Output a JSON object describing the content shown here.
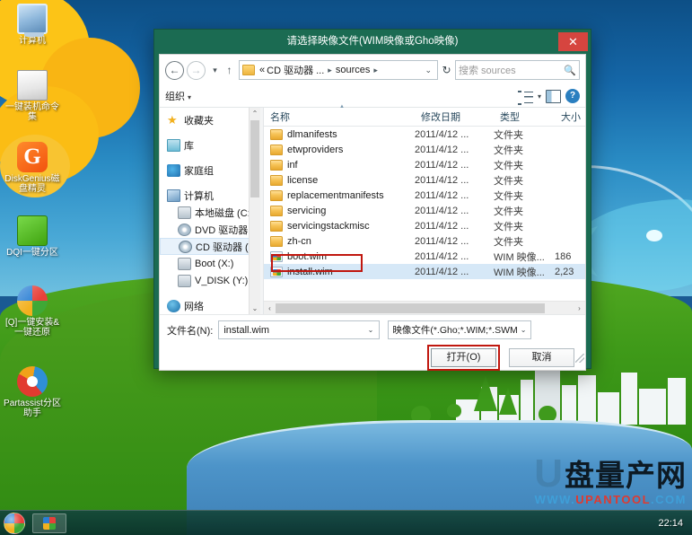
{
  "desktop": {
    "icons": [
      {
        "name": "computer",
        "label": "计算机",
        "icon": "computer-icon"
      },
      {
        "name": "one-key-command-set",
        "label": "一键装机命令集",
        "icon": "command-set-icon"
      },
      {
        "name": "diskgenius",
        "label": "DiskGenius磁盘精灵",
        "icon": "diskgenius-icon",
        "glyph": "G"
      },
      {
        "name": "dqi-partition",
        "label": "DQI一键分区",
        "icon": "partition-icon"
      },
      {
        "name": "q-install-restore",
        "label": "[Q]一键安装&一键还原",
        "icon": "windows-icon"
      },
      {
        "name": "partassist",
        "label": "Partassist分区助手",
        "icon": "partassist-icon"
      }
    ]
  },
  "dialog": {
    "title": "请选择映像文件(WIM映像或Gho映像)",
    "close_label": "✕",
    "nav": {
      "back_label": "←",
      "forward_label": "→",
      "recent_label": "▾",
      "up_label": "↑"
    },
    "address": {
      "prefix": "«",
      "segments": [
        "CD 驱动器 ...",
        "sources"
      ],
      "separator": "▸",
      "dropdown_label": "⌄",
      "refresh_label": "↻"
    },
    "search": {
      "placeholder": "搜索 sources",
      "value": "",
      "display": "搜索 sources",
      "icon": "search-icon"
    },
    "toolbar": {
      "organize_label": "组织",
      "organize_caret": "▾",
      "view_caret": "▾",
      "view_icon": "view-list-icon",
      "preview_icon": "preview-pane-icon",
      "help_label": "?"
    },
    "navpane": {
      "items": [
        {
          "label": "收藏夹",
          "icon": "star-icon",
          "level": 0,
          "selected": false,
          "spacer_after": true
        },
        {
          "label": "库",
          "icon": "library-icon",
          "level": 0,
          "selected": false,
          "spacer_after": true
        },
        {
          "label": "家庭组",
          "icon": "homegroup-icon",
          "level": 0,
          "selected": false,
          "spacer_after": true
        },
        {
          "label": "计算机",
          "icon": "computer-icon",
          "level": 0,
          "selected": false,
          "spacer_after": false
        },
        {
          "label": "本地磁盘 (C:)",
          "icon": "drive-icon",
          "level": 1,
          "selected": false,
          "spacer_after": false
        },
        {
          "label": "DVD 驱动器 (D:)",
          "icon": "dvd-drive-icon",
          "level": 1,
          "selected": false,
          "spacer_after": false
        },
        {
          "label": "CD 驱动器 (E:) G",
          "icon": "cd-drive-icon",
          "level": 1,
          "selected": true,
          "spacer_after": false
        },
        {
          "label": "Boot (X:)",
          "icon": "drive-icon",
          "level": 1,
          "selected": false,
          "spacer_after": false
        },
        {
          "label": "V_DISK (Y:)",
          "icon": "drive-icon",
          "level": 1,
          "selected": false,
          "spacer_after": true
        },
        {
          "label": "网络",
          "icon": "network-icon",
          "level": 0,
          "selected": false,
          "spacer_after": false
        }
      ],
      "scroll_up": "⌃",
      "scroll_down": "⌄"
    },
    "filelist": {
      "columns": [
        {
          "key": "name",
          "label": "名称",
          "sorted": true
        },
        {
          "key": "date",
          "label": "修改日期",
          "sorted": false
        },
        {
          "key": "type",
          "label": "类型",
          "sorted": false
        },
        {
          "key": "size",
          "label": "大小",
          "sorted": false
        }
      ],
      "rows": [
        {
          "name": "dlmanifests",
          "date": "2011/4/12 ...",
          "type": "文件夹",
          "size": "",
          "icon": "folder-icon",
          "selected": false
        },
        {
          "name": "etwproviders",
          "date": "2011/4/12 ...",
          "type": "文件夹",
          "size": "",
          "icon": "folder-icon",
          "selected": false
        },
        {
          "name": "inf",
          "date": "2011/4/12 ...",
          "type": "文件夹",
          "size": "",
          "icon": "folder-icon",
          "selected": false
        },
        {
          "name": "license",
          "date": "2011/4/12 ...",
          "type": "文件夹",
          "size": "",
          "icon": "folder-icon",
          "selected": false
        },
        {
          "name": "replacementmanifests",
          "date": "2011/4/12 ...",
          "type": "文件夹",
          "size": "",
          "icon": "folder-icon",
          "selected": false
        },
        {
          "name": "servicing",
          "date": "2011/4/12 ...",
          "type": "文件夹",
          "size": "",
          "icon": "folder-icon",
          "selected": false
        },
        {
          "name": "servicingstackmisc",
          "date": "2011/4/12 ...",
          "type": "文件夹",
          "size": "",
          "icon": "folder-icon",
          "selected": false
        },
        {
          "name": "zh-cn",
          "date": "2011/4/12 ...",
          "type": "文件夹",
          "size": "",
          "icon": "folder-icon",
          "selected": false
        },
        {
          "name": "boot.wim",
          "date": "2011/4/12 ...",
          "type": "WIM 映像...",
          "size": "186",
          "icon": "wim-file-icon",
          "selected": false
        },
        {
          "name": "install.wim",
          "date": "2011/4/12 ...",
          "type": "WIM 映像...",
          "size": "2,23",
          "icon": "wim-file-icon",
          "selected": true
        }
      ],
      "hscroll_left": "‹",
      "hscroll_right": "›"
    },
    "bottom": {
      "filename_label": "文件名(N):",
      "filename_value": "install.wim",
      "filename_caret": "⌄",
      "filter_value": "映像文件(*.Gho;*.WIM;*.SWM",
      "filter_caret": "⌄",
      "open_label": "打开(O)",
      "cancel_label": "取消"
    }
  },
  "taskbar": {
    "start_label": "start-orb",
    "task_button_label": "task-window",
    "clock": "22:14"
  },
  "watermark": {
    "logo_u": "U",
    "logo_cn": "盘量产网",
    "url_parts": [
      "WWW.",
      "UPANTOOL",
      ".COM"
    ]
  },
  "colors": {
    "window_frame": "#1b6b52",
    "close_button": "#d6453f",
    "selection": "#d6e8f7",
    "highlight_box": "#c0170f",
    "accent_blue": "#2a7fc0"
  }
}
